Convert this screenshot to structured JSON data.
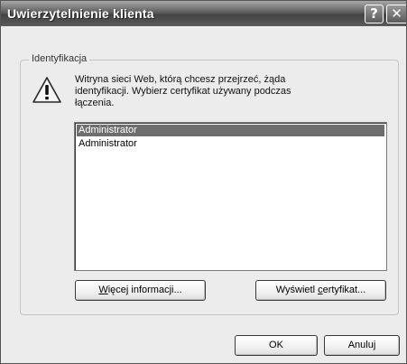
{
  "window": {
    "title": "Uwierzytelnienie klienta",
    "help_glyph": "?",
    "close_glyph": "✕"
  },
  "group": {
    "label": "Identyfikacja"
  },
  "message": {
    "line1": "Witryna sieci Web, którą chcesz przejrzeć, żąda",
    "line2": "identyfikacji. Wybierz certyfikat używany podczas",
    "line3": "łączenia."
  },
  "certificates": {
    "items": [
      "Administrator",
      "Administrator"
    ],
    "selected_index": 0
  },
  "buttons": {
    "more_info_mnemonic": "W",
    "more_info_rest": "ięcej informacji...",
    "view_cert_prefix": "Wyświetl ",
    "view_cert_mnemonic": "c",
    "view_cert_rest": "ertyfikat...",
    "ok": "OK",
    "cancel": "Anuluj"
  },
  "icons": {
    "warning": "warning-icon",
    "help": "help-icon",
    "close": "close-icon"
  },
  "colors": {
    "titlebar": "#5e5e5e",
    "dialog_bg": "#ececec",
    "selection": "#6e6e6e"
  }
}
